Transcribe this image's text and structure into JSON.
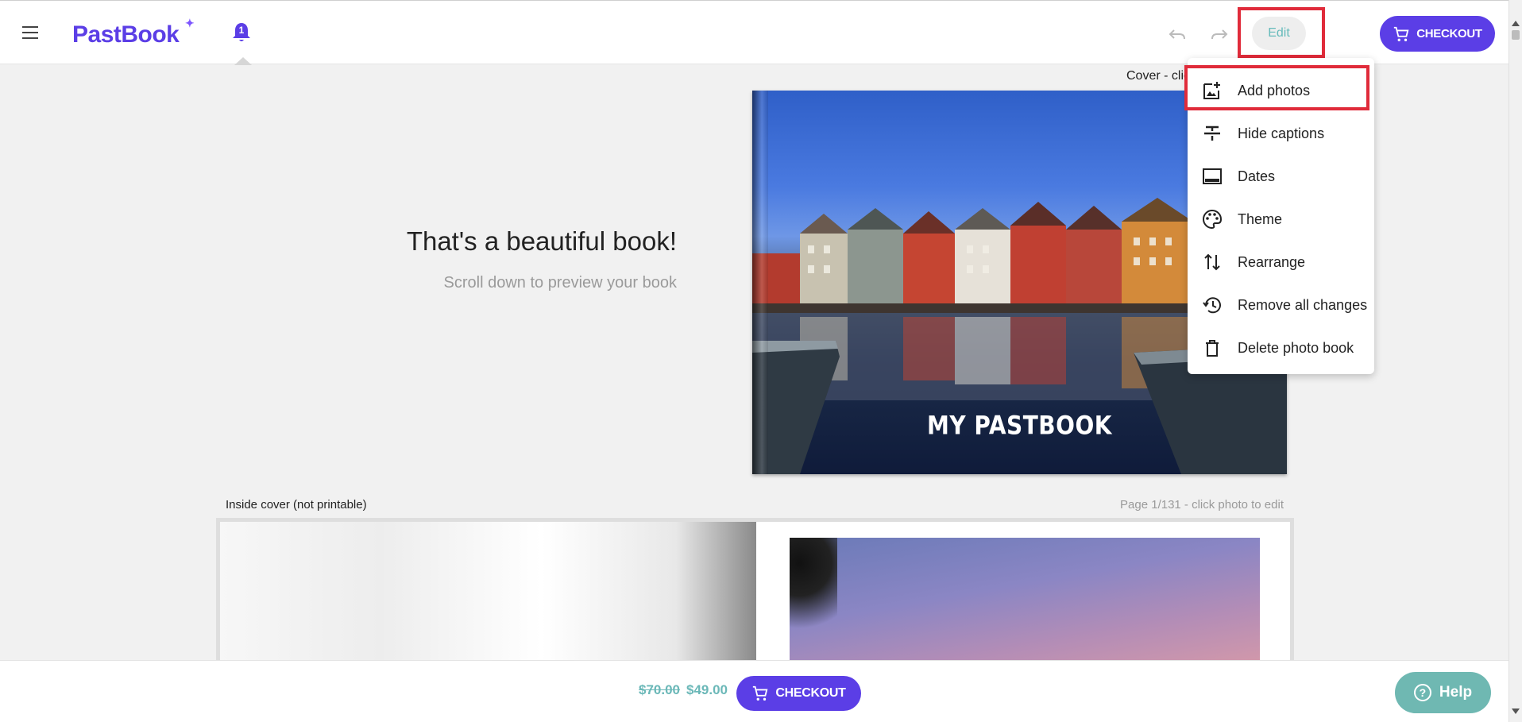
{
  "header": {
    "logo_text": "PastBook",
    "notification_count": "1",
    "edit_label": "Edit",
    "checkout_label": "CHECKOUT"
  },
  "menu": {
    "items": [
      {
        "label": "Add photos",
        "icon": "add-photo-icon"
      },
      {
        "label": "Hide captions",
        "icon": "strikethrough-icon"
      },
      {
        "label": "Dates",
        "icon": "calendar-frame-icon"
      },
      {
        "label": "Theme",
        "icon": "palette-icon"
      },
      {
        "label": "Rearrange",
        "icon": "swap-vertical-icon"
      },
      {
        "label": "Remove all changes",
        "icon": "history-icon"
      },
      {
        "label": "Delete photo book",
        "icon": "trash-icon"
      }
    ]
  },
  "main": {
    "cover_label": "Cover - clic",
    "headline": "That's a beautiful book!",
    "subline": "Scroll down to preview your book",
    "cover_title": "MY PASTBOOK",
    "inside_cover_label": "Inside cover (not printable)",
    "page_label": "Page 1/131  - click photo to edit"
  },
  "bottom": {
    "old_price": "$70.00",
    "new_price": "$49.00",
    "checkout_label": "CHECKOUT",
    "help_label": "Help"
  },
  "colors": {
    "brand": "#5b3ee6",
    "accent_teal": "#6fb8b2",
    "highlight_red": "#e02b3a"
  }
}
